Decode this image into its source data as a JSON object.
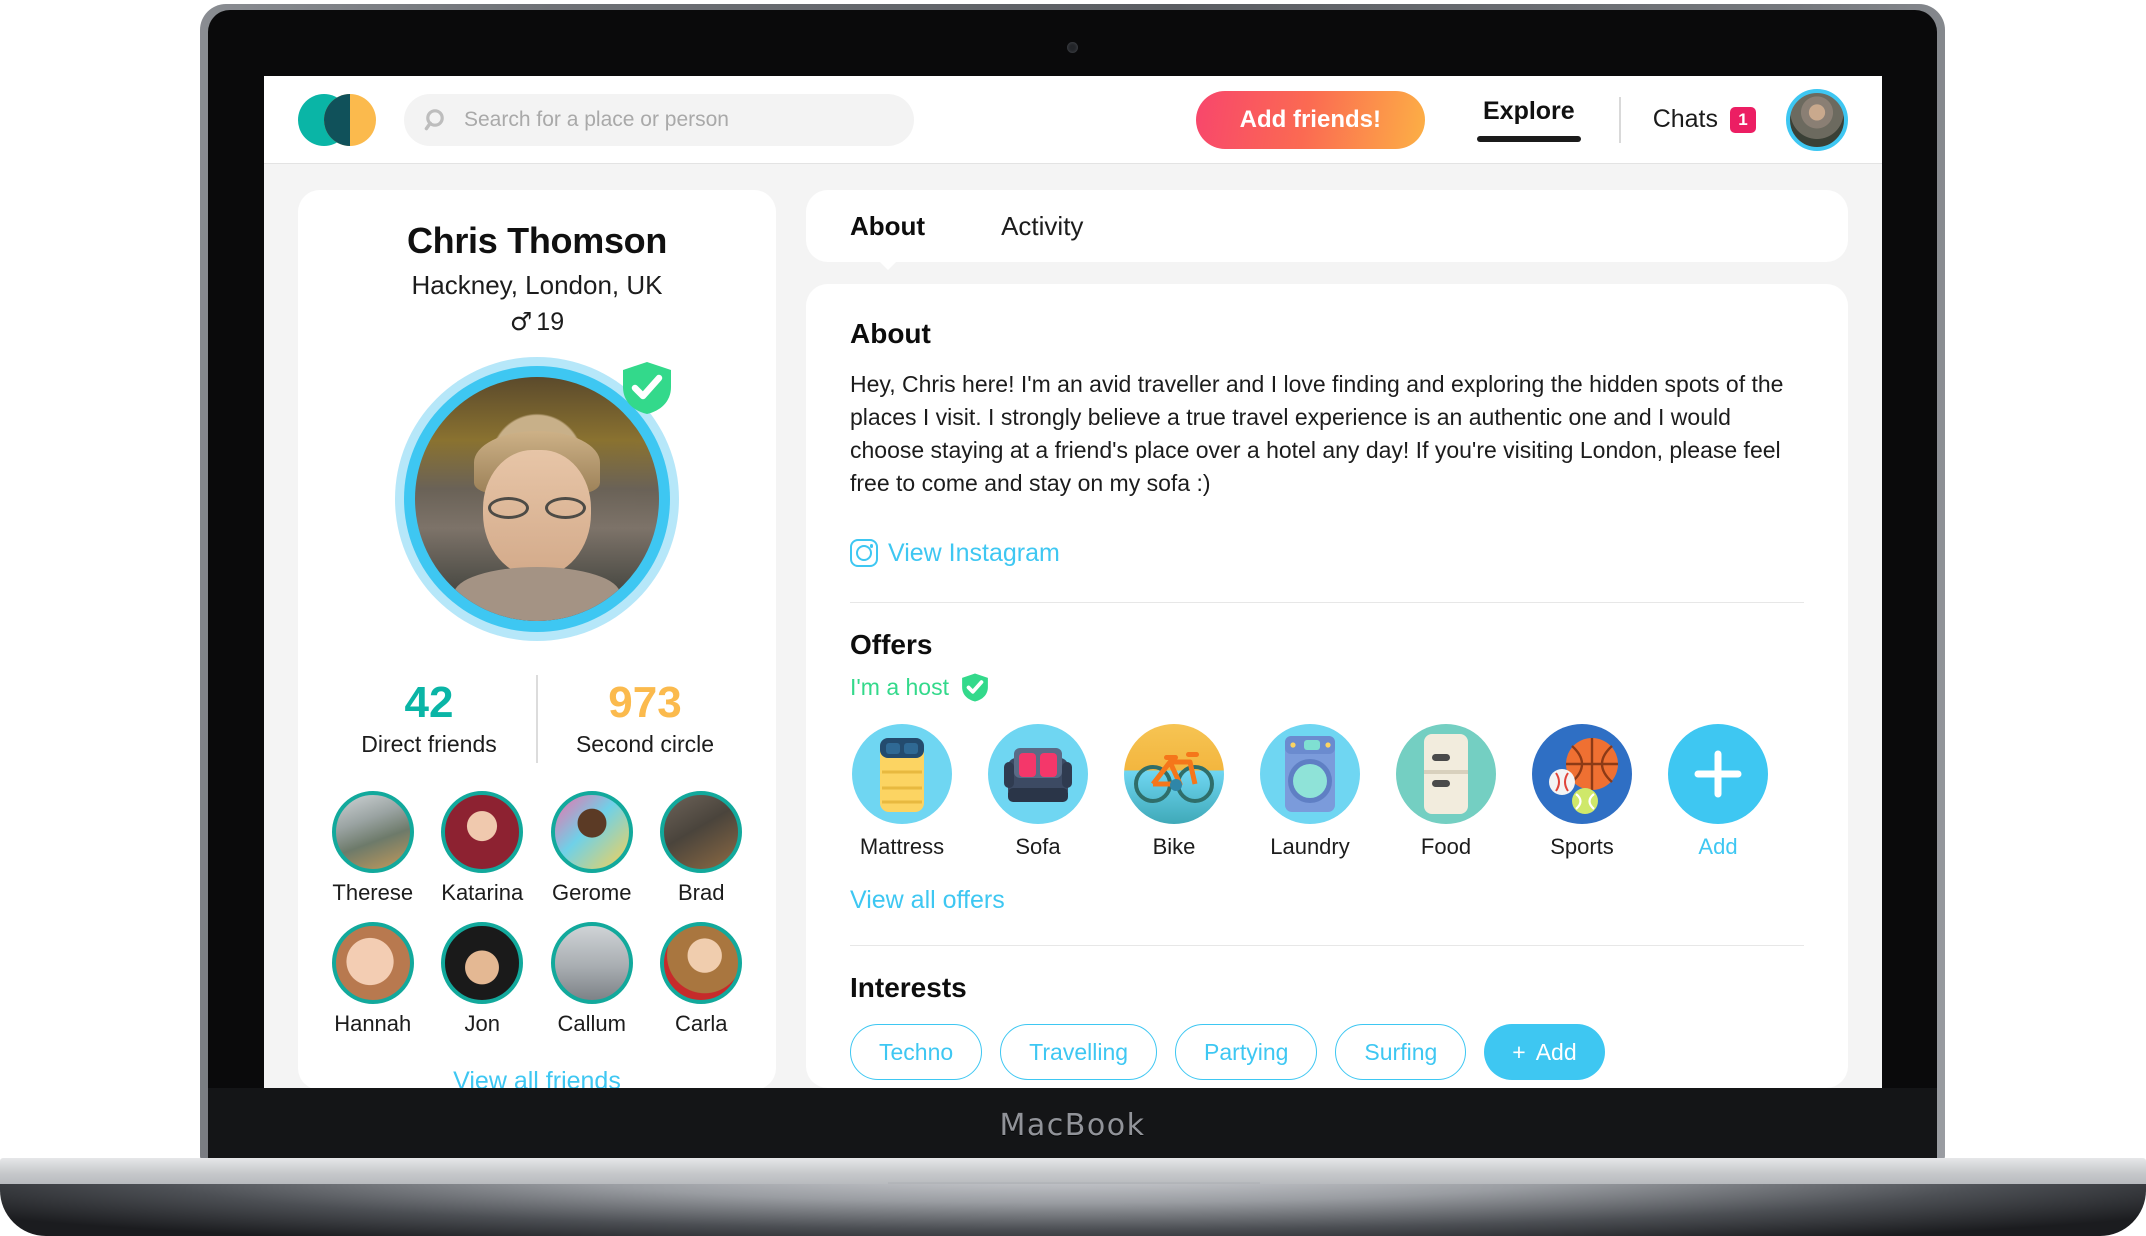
{
  "device": {
    "wordmark": "MacBook"
  },
  "header": {
    "logo_name": "app-logo",
    "search": {
      "placeholder": "Search for a place or person",
      "value": ""
    },
    "add_friends_label": "Add friends!",
    "nav": {
      "explore": "Explore",
      "chats": "Chats",
      "chats_badge": "1"
    },
    "avatar_name": "current-user-avatar"
  },
  "profile": {
    "name": "Chris Thomson",
    "location": "Hackney, London, UK",
    "gender_symbol": "♂",
    "age": "19",
    "verified": true,
    "stats": [
      {
        "value": "42",
        "label": "Direct friends",
        "color": "#0ab5a6"
      },
      {
        "value": "973",
        "label": "Second circle",
        "color": "#fbba4d"
      }
    ],
    "friends": [
      {
        "name": "Therese"
      },
      {
        "name": "Katarina"
      },
      {
        "name": "Gerome"
      },
      {
        "name": "Brad"
      },
      {
        "name": "Hannah"
      },
      {
        "name": "Jon"
      },
      {
        "name": "Callum"
      },
      {
        "name": "Carla"
      }
    ],
    "view_all_friends": "View all friends"
  },
  "tabs": [
    {
      "label": "About",
      "active": true
    },
    {
      "label": "Activity",
      "active": false
    }
  ],
  "about": {
    "title": "About",
    "text": "Hey, Chris here! I'm an avid traveller and I love finding and exploring the hidden spots of the places I visit. I strongly believe a true travel experience is an authentic one and I would choose staying at a friend's place over a hotel any day! If you're visiting London, please feel free to come and stay on my sofa :)",
    "instagram_label": "View Instagram"
  },
  "offers": {
    "title": "Offers",
    "host_label": "I'm a host",
    "items": [
      {
        "label": "Mattress",
        "icon": "mattress-icon"
      },
      {
        "label": "Sofa",
        "icon": "sofa-icon"
      },
      {
        "label": "Bike",
        "icon": "bike-icon"
      },
      {
        "label": "Laundry",
        "icon": "laundry-icon"
      },
      {
        "label": "Food",
        "icon": "fridge-icon"
      },
      {
        "label": "Sports",
        "icon": "sports-icon"
      },
      {
        "label": "Add",
        "icon": "plus-icon"
      }
    ],
    "view_all_label": "View all offers"
  },
  "interests": {
    "title": "Interests",
    "items": [
      "Techno",
      "Travelling",
      "Partying",
      "Surfing"
    ],
    "add_label": "Add",
    "add_symbol": "+"
  },
  "colors": {
    "accent_blue": "#3ec7f2",
    "teal": "#0ab5a6",
    "amber": "#fbba4d",
    "green": "#33d98b",
    "pink": "#ec1e63"
  }
}
